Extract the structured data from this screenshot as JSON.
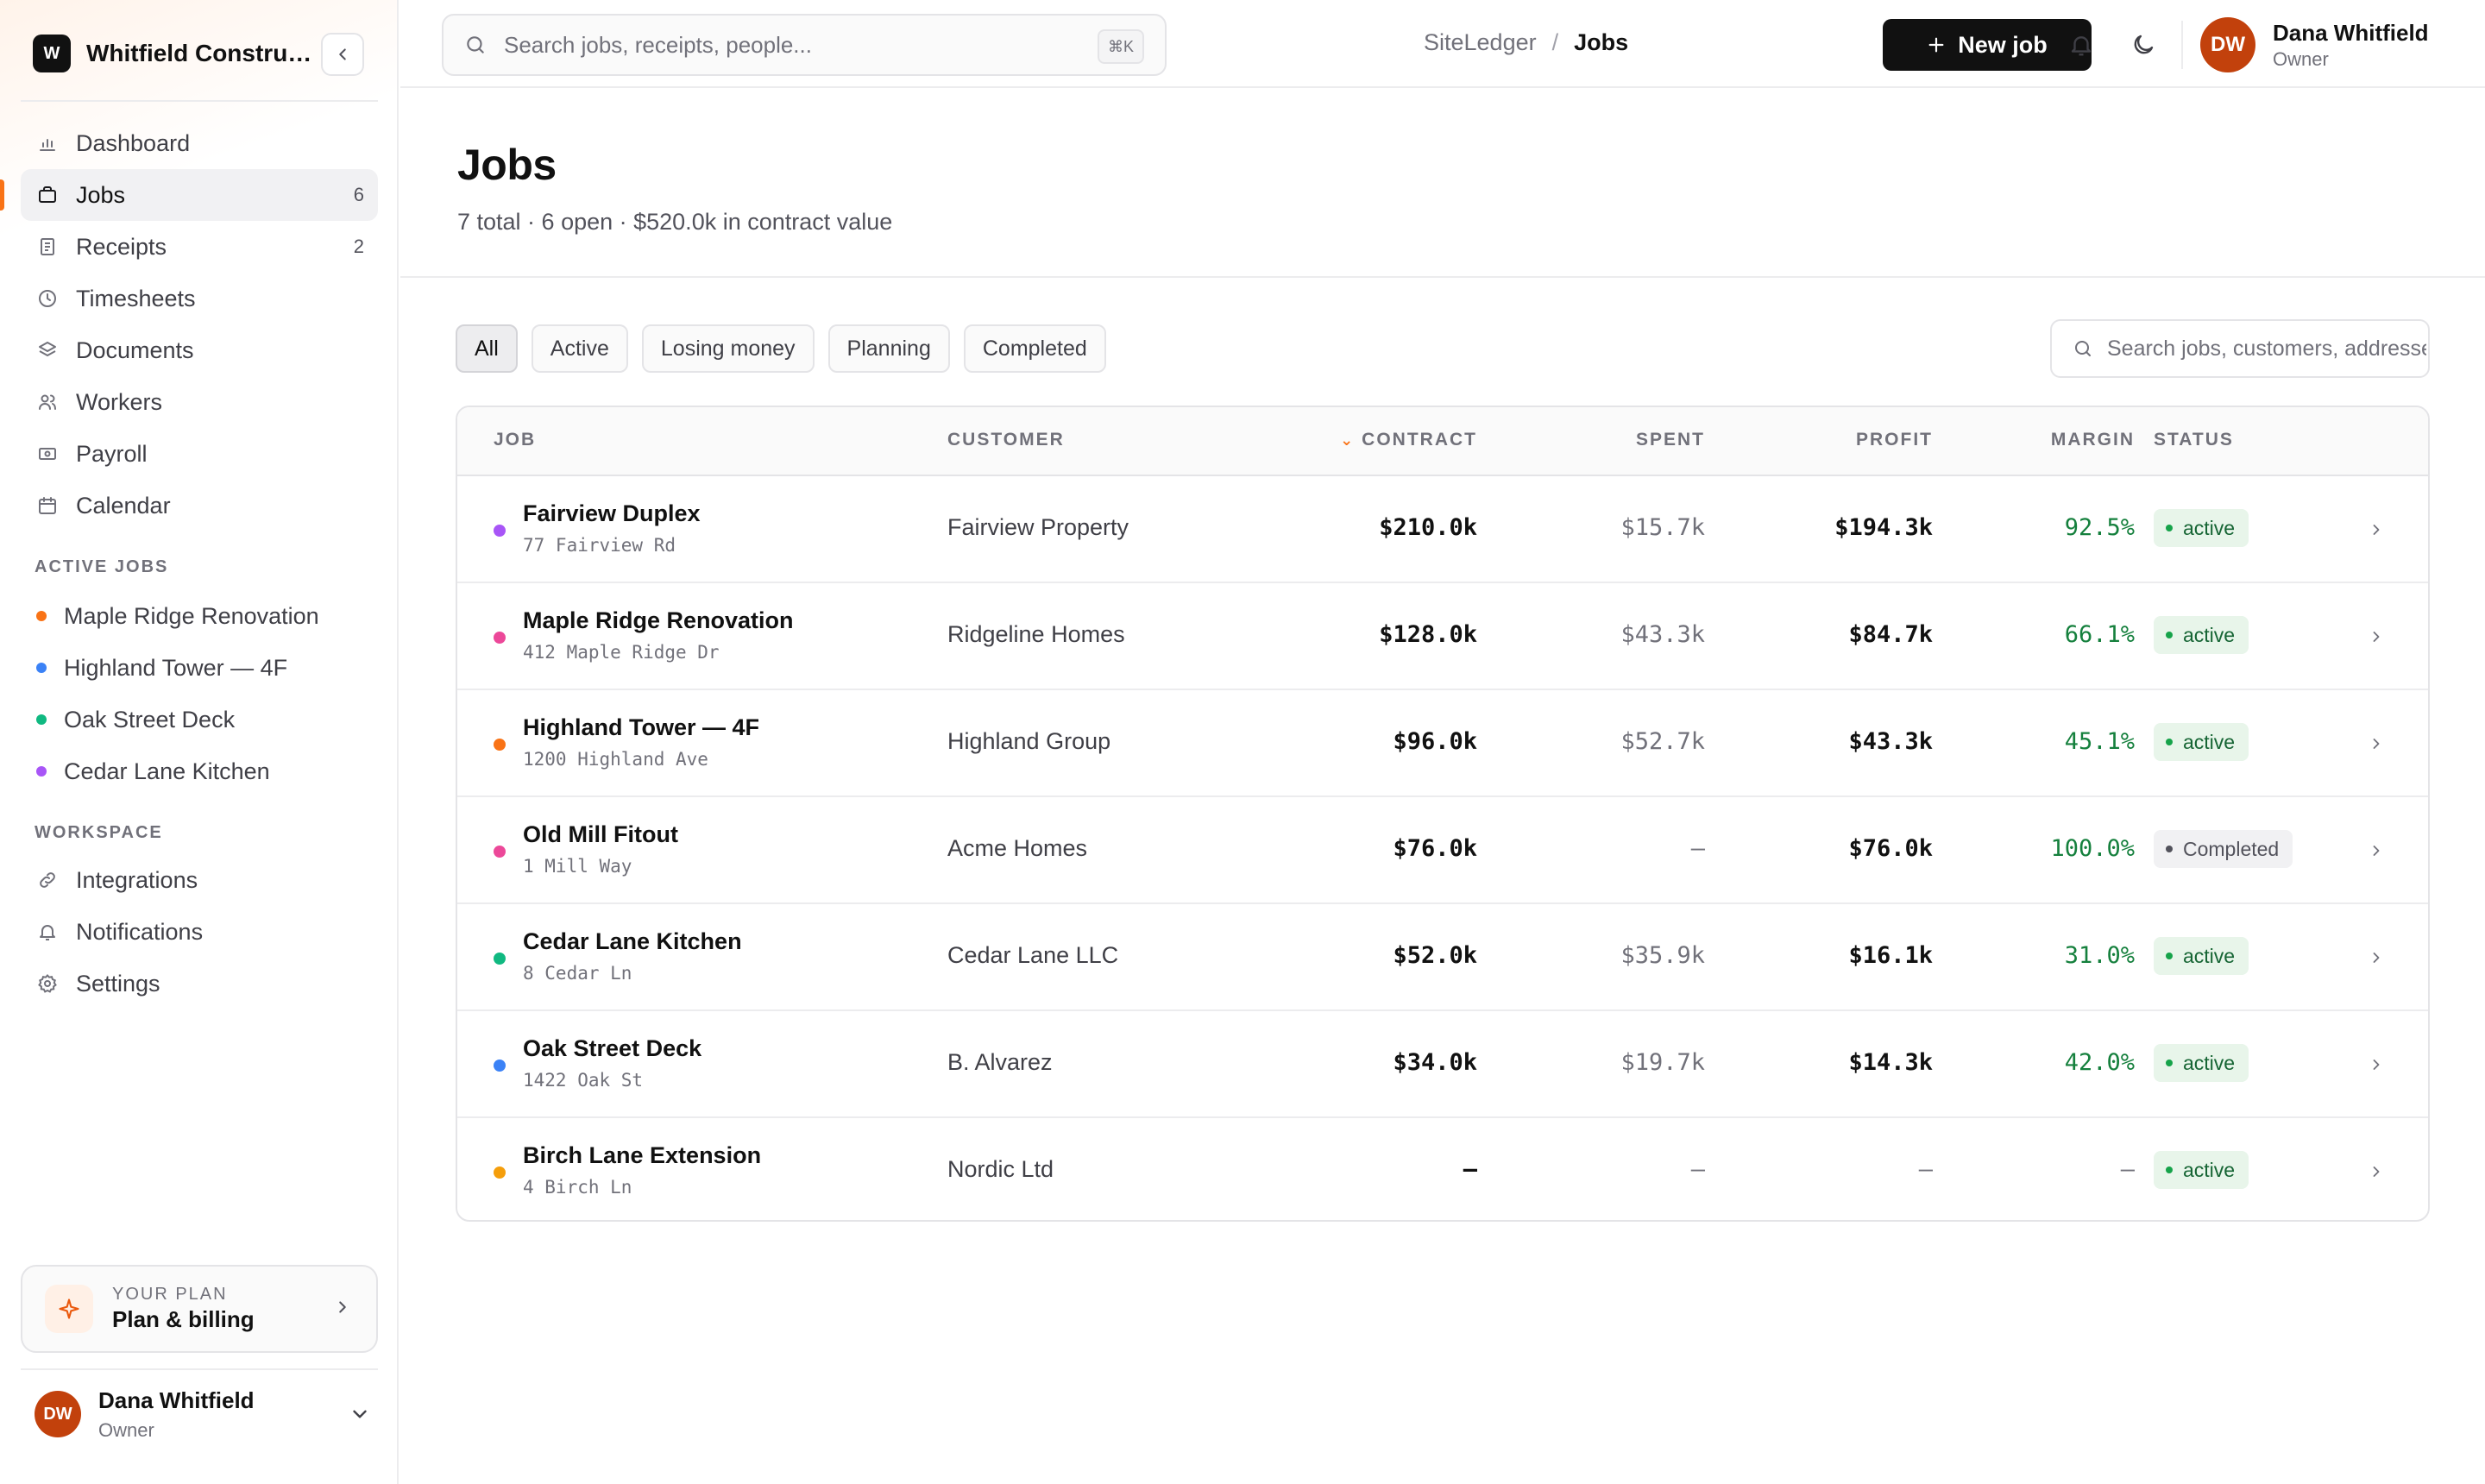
{
  "brand": {
    "logo_letter": "W",
    "name": "Whitfield Construc..."
  },
  "sidebar": {
    "nav": [
      {
        "label": "Dashboard",
        "icon": "bar-chart-icon"
      },
      {
        "label": "Jobs",
        "icon": "briefcase-icon",
        "count": "6",
        "active": true
      },
      {
        "label": "Receipts",
        "icon": "receipt-icon",
        "count": "2"
      },
      {
        "label": "Timesheets",
        "icon": "clock-icon"
      },
      {
        "label": "Documents",
        "icon": "layers-icon"
      },
      {
        "label": "Workers",
        "icon": "users-icon"
      },
      {
        "label": "Payroll",
        "icon": "banknote-icon"
      },
      {
        "label": "Calendar",
        "icon": "calendar-icon"
      }
    ],
    "active_jobs_label": "ACTIVE JOBS",
    "active_jobs": [
      {
        "label": "Maple Ridge Renovation",
        "color": "#f97316"
      },
      {
        "label": "Highland Tower — 4F",
        "color": "#3b82f6"
      },
      {
        "label": "Oak Street Deck",
        "color": "#10b981"
      },
      {
        "label": "Cedar Lane Kitchen",
        "color": "#a855f7"
      }
    ],
    "workspace_label": "WORKSPACE",
    "workspace": [
      {
        "label": "Integrations",
        "icon": "link-icon"
      },
      {
        "label": "Notifications",
        "icon": "bell-icon"
      },
      {
        "label": "Settings",
        "icon": "gear-icon"
      }
    ],
    "plan": {
      "label": "YOUR PLAN",
      "title": "Plan & billing"
    },
    "user": {
      "initials": "DW",
      "name": "Dana Whitfield",
      "role": "Owner"
    }
  },
  "header": {
    "search_placeholder": "Search jobs, receipts, people...",
    "shortcut": "⌘K",
    "breadcrumb_root": "SiteLedger",
    "breadcrumb_sep": "/",
    "breadcrumb_current": "Jobs",
    "new_job_label": "New job",
    "user": {
      "initials": "DW",
      "name": "Dana Whitfield",
      "role": "Owner"
    }
  },
  "page": {
    "title": "Jobs",
    "subtitle": "7 total · 6 open · $520.0k in contract value"
  },
  "filters": [
    {
      "label": "All",
      "active": true
    },
    {
      "label": "Active"
    },
    {
      "label": "Losing money"
    },
    {
      "label": "Planning"
    },
    {
      "label": "Completed"
    }
  ],
  "table_search_placeholder": "Search jobs, customers, addresses",
  "table": {
    "columns": {
      "job": "JOB",
      "customer": "CUSTOMER",
      "contract": "CONTRACT",
      "spent": "SPENT",
      "profit": "PROFIT",
      "margin": "MARGIN",
      "status": "STATUS"
    },
    "rows": [
      {
        "name": "Fairview Duplex",
        "address": "77 Fairview Rd",
        "color": "#a855f7",
        "customer": "Fairview Property",
        "contract": "$210.0k",
        "spent": "$15.7k",
        "profit": "$194.3k",
        "margin": "92.5%",
        "status": "active"
      },
      {
        "name": "Maple Ridge Renovation",
        "address": "412 Maple Ridge Dr",
        "color": "#ec4899",
        "customer": "Ridgeline Homes",
        "contract": "$128.0k",
        "spent": "$43.3k",
        "profit": "$84.7k",
        "margin": "66.1%",
        "status": "active"
      },
      {
        "name": "Highland Tower — 4F",
        "address": "1200 Highland Ave",
        "color": "#f97316",
        "customer": "Highland Group",
        "contract": "$96.0k",
        "spent": "$52.7k",
        "profit": "$43.3k",
        "margin": "45.1%",
        "status": "active"
      },
      {
        "name": "Old Mill Fitout",
        "address": "1 Mill Way",
        "color": "#ec4899",
        "customer": "Acme Homes",
        "contract": "$76.0k",
        "spent": "–",
        "profit": "$76.0k",
        "margin": "100.0%",
        "status": "Completed"
      },
      {
        "name": "Cedar Lane Kitchen",
        "address": "8 Cedar Ln",
        "color": "#10b981",
        "customer": "Cedar Lane LLC",
        "contract": "$52.0k",
        "spent": "$35.9k",
        "profit": "$16.1k",
        "margin": "31.0%",
        "status": "active"
      },
      {
        "name": "Oak Street Deck",
        "address": "1422 Oak St",
        "color": "#3b82f6",
        "customer": "B. Alvarez",
        "contract": "$34.0k",
        "spent": "$19.7k",
        "profit": "$14.3k",
        "margin": "42.0%",
        "status": "active"
      },
      {
        "name": "Birch Lane Extension",
        "address": "4 Birch Ln",
        "color": "#f59e0b",
        "customer": "Nordic Ltd",
        "contract": "–",
        "spent": "–",
        "profit": "–",
        "margin": "–",
        "status": "active"
      }
    ]
  }
}
